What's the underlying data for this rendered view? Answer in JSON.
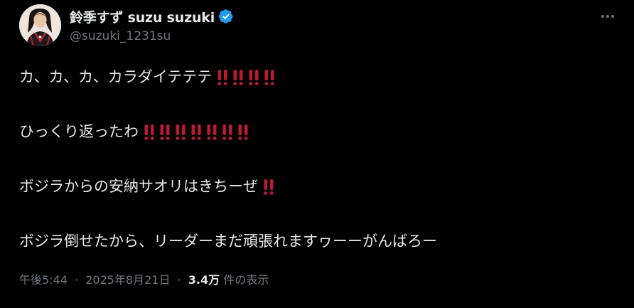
{
  "author": {
    "display_name": "鈴季すず suzu suzuki",
    "handle": "@suzuki_1231su",
    "verified": true
  },
  "tweet": {
    "paragraphs": [
      {
        "text": "カ、カ、カ、カラダイテテテ",
        "bang_count": 4
      },
      {
        "text": "ひっくり返ったわ",
        "bang_count": 7
      },
      {
        "text": "ボジラからの安納サオリはきちーぜ",
        "bang_count": 1
      },
      {
        "text": "ボジラ倒せたから、リーダーまだ頑張れますヮーーがんばろー",
        "bang_count": 0
      }
    ],
    "emoji": "‼️"
  },
  "meta": {
    "time": "午後5:44",
    "date": "2025年8月21日",
    "separator": "·",
    "views_count": "3.4万",
    "views_label": "件の表示"
  },
  "colors": {
    "background": "#000000",
    "text": "#e7e9ea",
    "muted": "#71767b",
    "verified_blue": "#1d9bf0",
    "bang_red": "#be1931"
  },
  "icons": {
    "verified": "verified-badge-icon",
    "more": "more-options-icon",
    "bang": "double-exclamation-icon"
  }
}
